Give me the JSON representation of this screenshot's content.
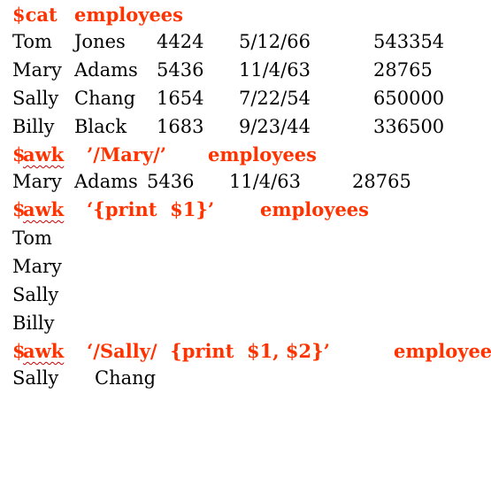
{
  "colors": {
    "command": "#ff3300",
    "output": "#000000",
    "background": "#ffffff"
  },
  "line1": {
    "prompt": "$cat",
    "args": "employees"
  },
  "table": [
    [
      "Tom",
      "Jones",
      "4424",
      "5/12/66",
      "543354"
    ],
    [
      "Mary",
      "Adams",
      "5436",
      "11/4/63",
      "28765"
    ],
    [
      "Sally",
      "Chang",
      "1654",
      "7/22/54",
      "650000"
    ],
    [
      "Billy",
      "Black",
      "1683",
      "9/23/44",
      "336500"
    ]
  ],
  "cmd2": {
    "dollar": "$",
    "awk": "awk",
    "pattern": "’/Mary/’",
    "file": "employees"
  },
  "out2": [
    "Mary",
    "Adams",
    "5436",
    "11/4/63",
    "28765"
  ],
  "cmd3": {
    "dollar": "$",
    "awk": "awk",
    "pattern": "‘{print  $1}’",
    "file": "employees"
  },
  "out3": [
    "Tom",
    "Mary",
    "Sally",
    "Billy"
  ],
  "cmd4": {
    "dollar": "$",
    "awk": "awk",
    "pattern": "‘/Sally/  {print  $1, $2}’",
    "file": "employees"
  },
  "out4": [
    "Sally",
    "Chang"
  ]
}
